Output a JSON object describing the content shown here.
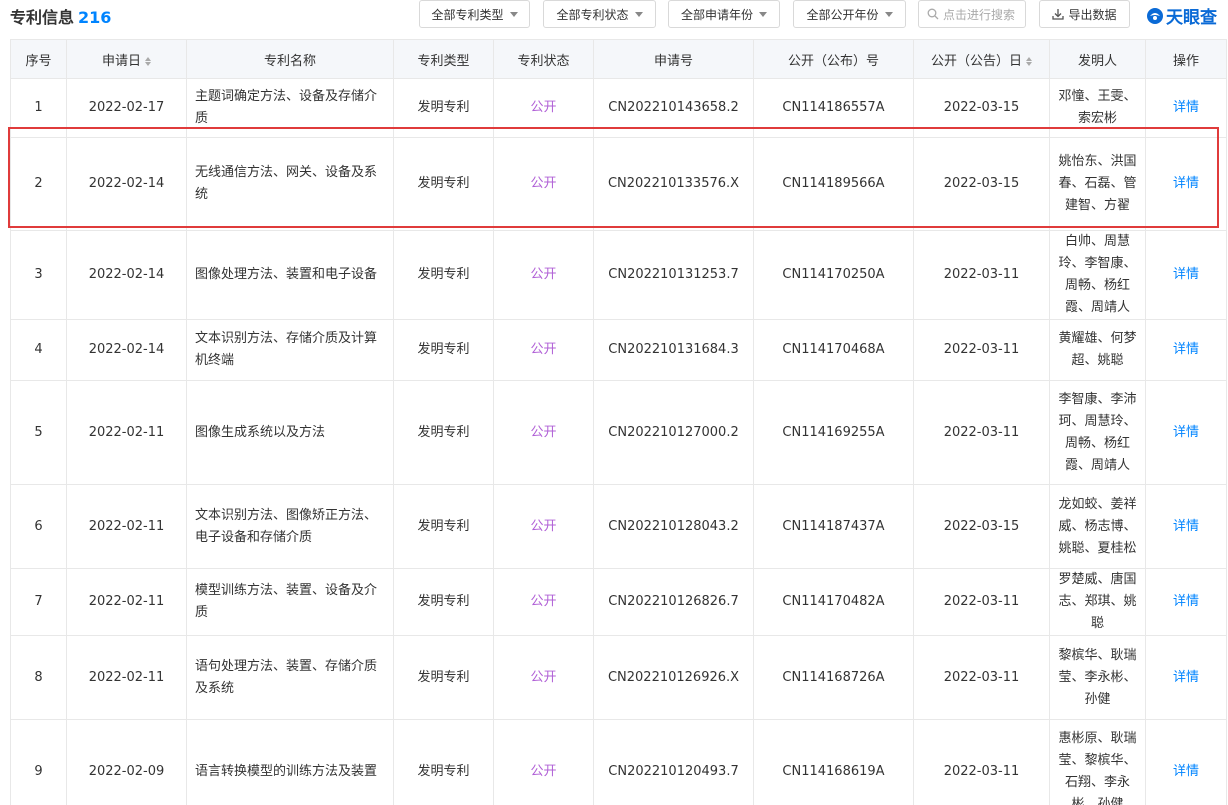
{
  "header": {
    "title": "专利信息",
    "count": "216",
    "filters": [
      "全部专利类型",
      "全部专利状态",
      "全部申请年份",
      "全部公开年份"
    ],
    "search_placeholder": "点击进行搜索",
    "export_label": "导出数据",
    "logo_text": "天眼查"
  },
  "table": {
    "columns": [
      "序号",
      "申请日",
      "专利名称",
      "专利类型",
      "专利状态",
      "申请号",
      "公开（公布）号",
      "公开（公告）日",
      "发明人",
      "操作"
    ],
    "rows": [
      {
        "no": "1",
        "date": "2022-02-17",
        "name": "主题词确定方法、设备及存储介质",
        "type": "发明专利",
        "status": "公开",
        "app_no": "CN202210143658.2",
        "pub_no": "CN114186557A",
        "pub_date": "2022-03-15",
        "inventors": "邓憧、王雯、索宏彬",
        "action": "详情"
      },
      {
        "no": "2",
        "date": "2022-02-14",
        "name": "无线通信方法、网关、设备及系统",
        "type": "发明专利",
        "status": "公开",
        "app_no": "CN202210133576.X",
        "pub_no": "CN114189566A",
        "pub_date": "2022-03-15",
        "inventors": "姚怡东、洪国春、石磊、管建智、方翟",
        "action": "详情"
      },
      {
        "no": "3",
        "date": "2022-02-14",
        "name": "图像处理方法、装置和电子设备",
        "type": "发明专利",
        "status": "公开",
        "app_no": "CN202210131253.7",
        "pub_no": "CN114170250A",
        "pub_date": "2022-03-11",
        "inventors": "白帅、周慧玲、李智康、周畅、杨红霞、周靖人",
        "action": "详情"
      },
      {
        "no": "4",
        "date": "2022-02-14",
        "name": "文本识别方法、存储介质及计算机终端",
        "type": "发明专利",
        "status": "公开",
        "app_no": "CN202210131684.3",
        "pub_no": "CN114170468A",
        "pub_date": "2022-03-11",
        "inventors": "黄耀雄、何梦超、姚聪",
        "action": "详情"
      },
      {
        "no": "5",
        "date": "2022-02-11",
        "name": "图像生成系统以及方法",
        "type": "发明专利",
        "status": "公开",
        "app_no": "CN202210127000.2",
        "pub_no": "CN114169255A",
        "pub_date": "2022-03-11",
        "inventors": "李智康、李沛珂、周慧玲、周畅、杨红霞、周靖人",
        "action": "详情"
      },
      {
        "no": "6",
        "date": "2022-02-11",
        "name": "文本识别方法、图像矫正方法、电子设备和存储介质",
        "type": "发明专利",
        "status": "公开",
        "app_no": "CN202210128043.2",
        "pub_no": "CN114187437A",
        "pub_date": "2022-03-15",
        "inventors": "龙如蛟、姜祥威、杨志博、姚聪、夏桂松",
        "action": "详情"
      },
      {
        "no": "7",
        "date": "2022-02-11",
        "name": "模型训练方法、装置、设备及介质",
        "type": "发明专利",
        "status": "公开",
        "app_no": "CN202210126826.7",
        "pub_no": "CN114170482A",
        "pub_date": "2022-03-11",
        "inventors": "罗楚威、唐国志、郑琪、姚聪",
        "action": "详情"
      },
      {
        "no": "8",
        "date": "2022-02-11",
        "name": "语句处理方法、装置、存储介质及系统",
        "type": "发明专利",
        "status": "公开",
        "app_no": "CN202210126926.X",
        "pub_no": "CN114168726A",
        "pub_date": "2022-03-11",
        "inventors": "黎槟华、耿瑞莹、李永彬、孙健",
        "action": "详情"
      },
      {
        "no": "9",
        "date": "2022-02-09",
        "name": "语言转换模型的训练方法及装置",
        "type": "发明专利",
        "status": "公开",
        "app_no": "CN202210120493.7",
        "pub_no": "CN114168619A",
        "pub_date": "2022-03-11",
        "inventors": "惠彬原、耿瑞莹、黎槟华、石翔、李永彬、孙健",
        "action": "详情"
      }
    ]
  }
}
